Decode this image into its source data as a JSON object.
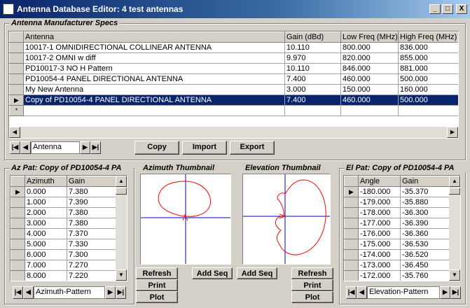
{
  "window": {
    "title": "Antenna Database Editor: 4 test antennas",
    "min": "_",
    "max": "□",
    "close": "X"
  },
  "manufacturer": {
    "legend": "Antenna Manufacturer Specs",
    "columns": [
      "Antenna",
      "Gain (dBd)",
      "Low Freq (MHz)",
      "High Freq (MHz)"
    ],
    "rows": [
      [
        "10017-1 OMNIDIRECTIONAL COLLINEAR ANTENNA",
        "10.110",
        "800.000",
        "836.000"
      ],
      [
        "10017-2 OMNI w diff",
        "9.970",
        "820.000",
        "855.000"
      ],
      [
        "PD10017-3 NO H Pattern",
        "10.110",
        "846.000",
        "881.000"
      ],
      [
        "PD10054-4 PANEL DIRECTIONAL ANTENNA",
        "7.400",
        "460.000",
        "500.000"
      ],
      [
        "My New Antenna",
        "3.000",
        "150.000",
        "160.000"
      ],
      [
        "Copy of PD10054-4 PANEL DIRECTIONAL ANTENNA",
        "7.400",
        "460.000",
        "500.000"
      ]
    ],
    "current_marker": "▶",
    "new_marker": "*",
    "nav_value": "Antenna",
    "copy": "Copy",
    "import": "Import",
    "export": "Export"
  },
  "az": {
    "legend": "Az Pat: Copy of PD10054-4 PA",
    "columns": [
      "Azimuth",
      "Gain"
    ],
    "rows": [
      [
        "0.000",
        "7.380"
      ],
      [
        "1.000",
        "7.390"
      ],
      [
        "2.000",
        "7.380"
      ],
      [
        "3.000",
        "7.380"
      ],
      [
        "4.000",
        "7.370"
      ],
      [
        "5.000",
        "7.330"
      ],
      [
        "6.000",
        "7.300"
      ],
      [
        "7.000",
        "7.270"
      ],
      [
        "8.000",
        "7.220"
      ]
    ],
    "nav_value": "Azimuth-Pattern"
  },
  "az_thumb": {
    "legend": "Azimuth Thumbnail",
    "refresh": "Refresh",
    "print": "Print",
    "plot": "Plot",
    "addseq": "Add Seq"
  },
  "el_thumb": {
    "legend": "Elevation Thumbnail",
    "refresh": "Refresh",
    "print": "Print",
    "plot": "Plot",
    "addseq": "Add Seq"
  },
  "el": {
    "legend": "El Pat: Copy of PD10054-4 PA",
    "columns": [
      "Angle",
      "Gain"
    ],
    "rows": [
      [
        "-180.000",
        "-35.370"
      ],
      [
        "-179.000",
        "-35.880"
      ],
      [
        "-178.000",
        "-36.300"
      ],
      [
        "-177.000",
        "-36.390"
      ],
      [
        "-176.000",
        "-36.360"
      ],
      [
        "-175.000",
        "-36.530"
      ],
      [
        "-174.000",
        "-36.520"
      ],
      [
        "-173.000",
        "-36.450"
      ],
      [
        "-172.000",
        "-35.760"
      ]
    ],
    "nav_value": "Elevation-Pattern"
  },
  "nav_icons": {
    "first": "|◀",
    "prev": "◀",
    "next": "▶",
    "last": "▶|"
  },
  "colors": {
    "title_start": "#0a246a",
    "selection": "#0a246a",
    "pattern": "#ff0000",
    "axis": "#0000c0"
  }
}
